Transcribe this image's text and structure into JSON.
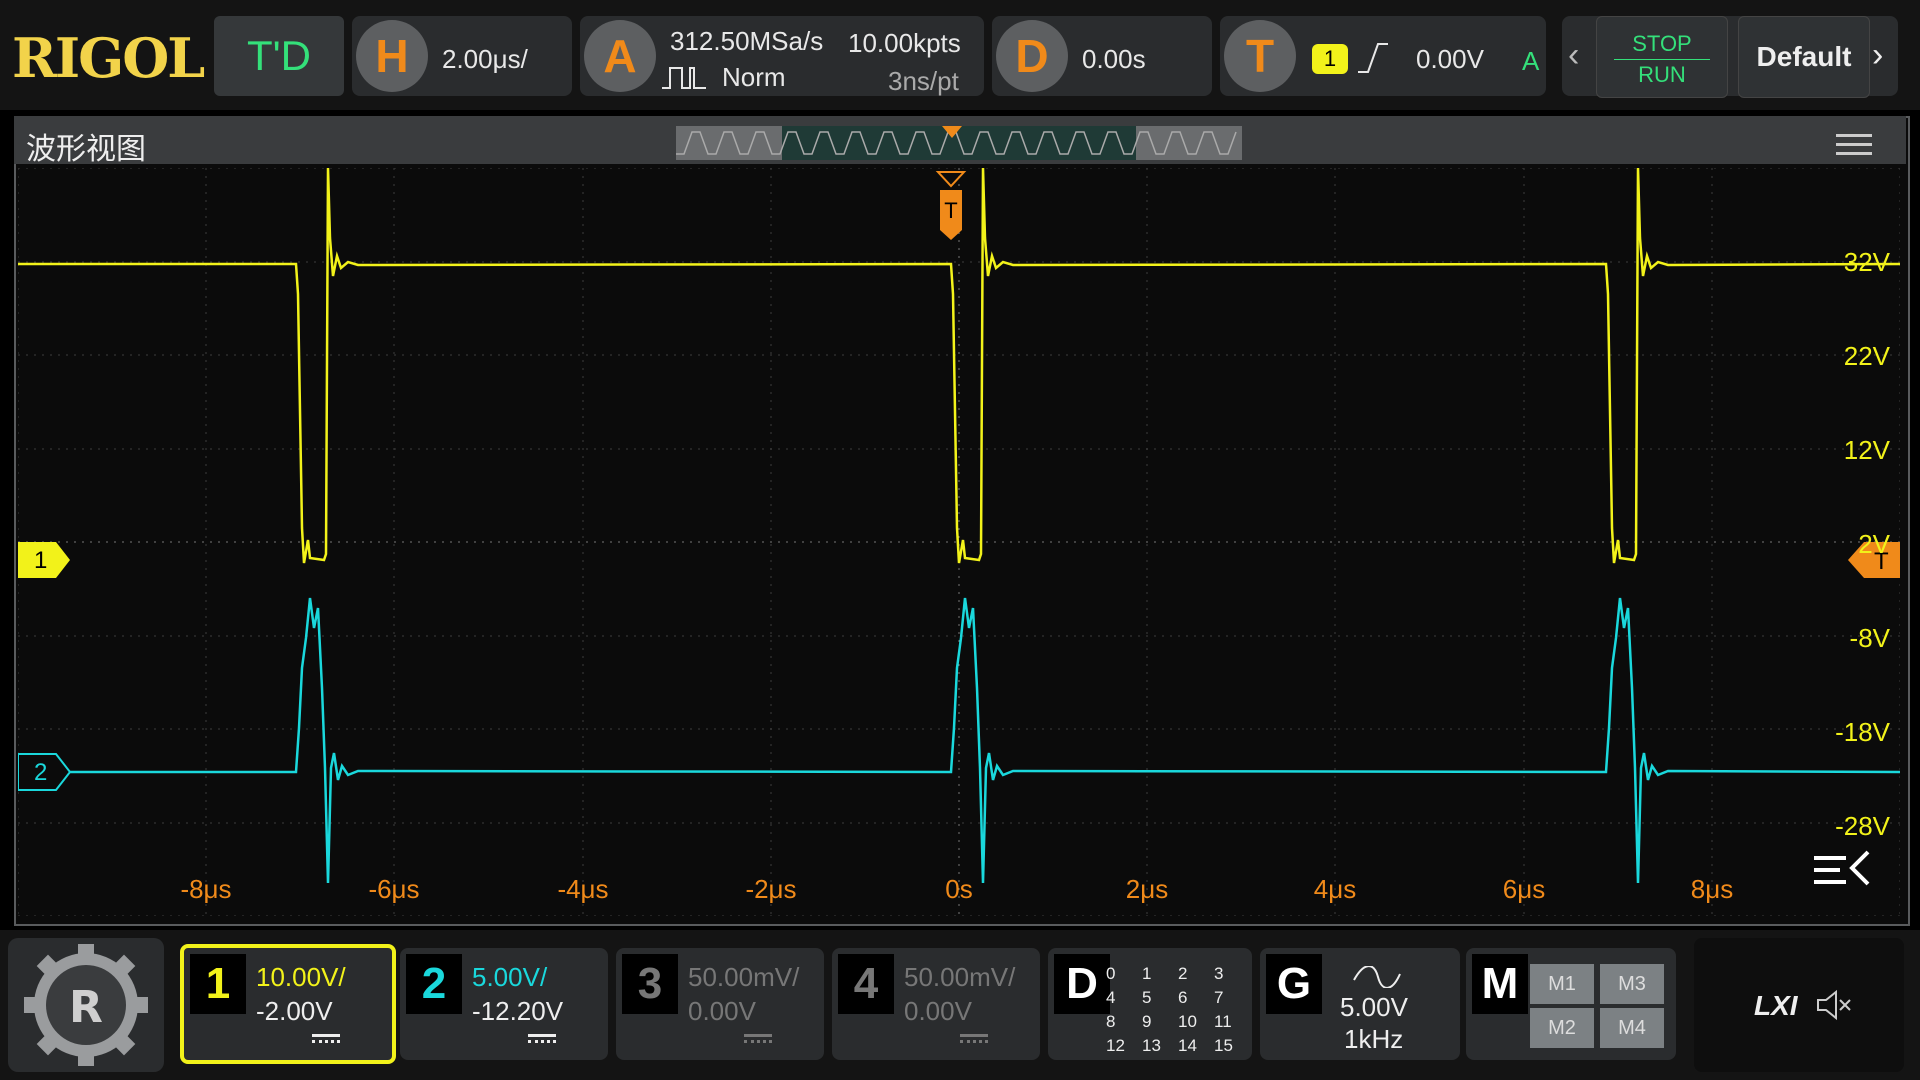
{
  "brand": {
    "logo": "RIGOL",
    "mode": "T'D"
  },
  "horizontal": {
    "icon": "H",
    "scale": "2.00μs/"
  },
  "acquire": {
    "icon": "A",
    "rate": "312.50MSa/s",
    "depth": "10.00kpts",
    "mode": "Norm",
    "resolution": "3ns/pt"
  },
  "delay": {
    "icon": "D",
    "value": "0.00s"
  },
  "trigger": {
    "icon": "T",
    "source": "1",
    "level": "0.00V",
    "sweep": "A"
  },
  "controls": {
    "stop": "STOP",
    "run": "RUN",
    "default": "Default"
  },
  "screen": {
    "title": "波形视图"
  },
  "waveform": {
    "trigger_marker": "T",
    "ch1_marker": "1",
    "ch2_marker": "2",
    "level_marker": "T",
    "volt_labels": [
      "32V",
      "22V",
      "12V",
      "2V",
      "-8V",
      "-18V",
      "-28V"
    ],
    "time_labels": [
      "-8μs",
      "-6μs",
      "-4μs",
      "-2μs",
      "0s",
      "2μs",
      "4μs",
      "6μs",
      "8μs"
    ],
    "ch1_color": "#f2f21a",
    "ch2_color": "#1ad8dc",
    "trigger_color": "#f08a1a"
  },
  "channels": [
    {
      "num": "1",
      "scale": "10.00V/",
      "offset": "-2.00V",
      "color": "#f2f21a"
    },
    {
      "num": "2",
      "scale": "5.00V/",
      "offset": "-12.20V",
      "color": "#1ad8dc"
    },
    {
      "num": "3",
      "scale": "50.00mV/",
      "offset": "0.00V",
      "color": "#777777"
    },
    {
      "num": "4",
      "scale": "50.00mV/",
      "offset": "0.00V",
      "color": "#777777"
    }
  ],
  "digital": {
    "icon": "D",
    "bits": [
      "0",
      "1",
      "2",
      "3",
      "4",
      "5",
      "6",
      "7",
      "8",
      "9",
      "10",
      "11",
      "12",
      "13",
      "14",
      "15"
    ]
  },
  "generator": {
    "icon": "G",
    "amplitude": "5.00V",
    "frequency": "1kHz"
  },
  "math": {
    "icon": "M",
    "items": [
      "M1",
      "M3",
      "M2",
      "M4"
    ]
  },
  "status": {
    "lxi": "LXI"
  }
}
